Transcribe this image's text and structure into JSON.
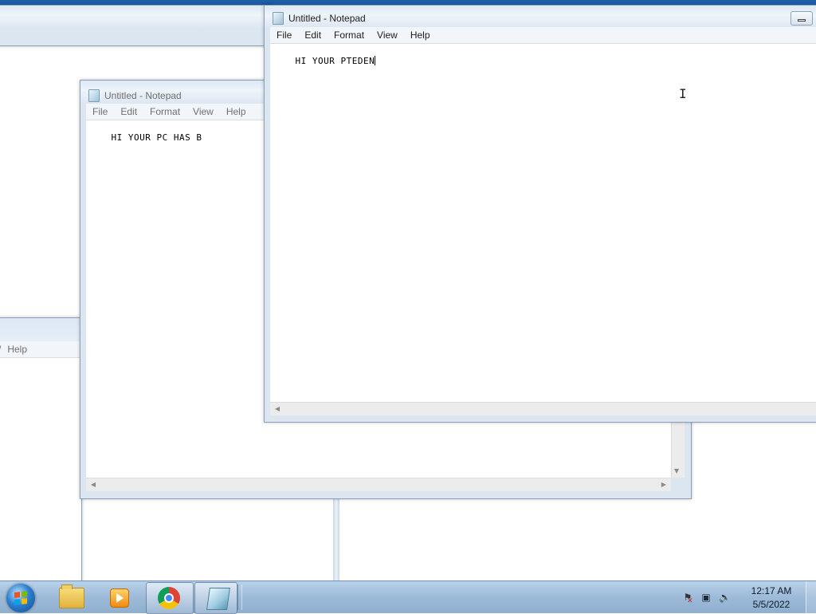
{
  "bg_window": {
    "menu": [
      "",
      "Help"
    ]
  },
  "notepad_back": {
    "title": "Untitled - Notepad",
    "menu": [
      "File",
      "Edit",
      "Format",
      "View",
      "Help"
    ],
    "content": "HI YOUR PC HAS B"
  },
  "notepad_front": {
    "title": "Untitled - Notepad",
    "menu": [
      "File",
      "Edit",
      "Format",
      "View",
      "Help"
    ],
    "content": "HI YOUR PTEDEN"
  },
  "taskbar": {
    "apps": [
      {
        "icon": "folder-icon",
        "active": false
      },
      {
        "icon": "media-player-icon",
        "active": false
      },
      {
        "icon": "chrome-icon",
        "active": true
      },
      {
        "icon": "notepad-icon",
        "active": true
      }
    ],
    "tray": [
      "action-center-icon",
      "network-icon",
      "volume-icon"
    ],
    "time": "12:17 AM",
    "date": "5/5/2022"
  }
}
